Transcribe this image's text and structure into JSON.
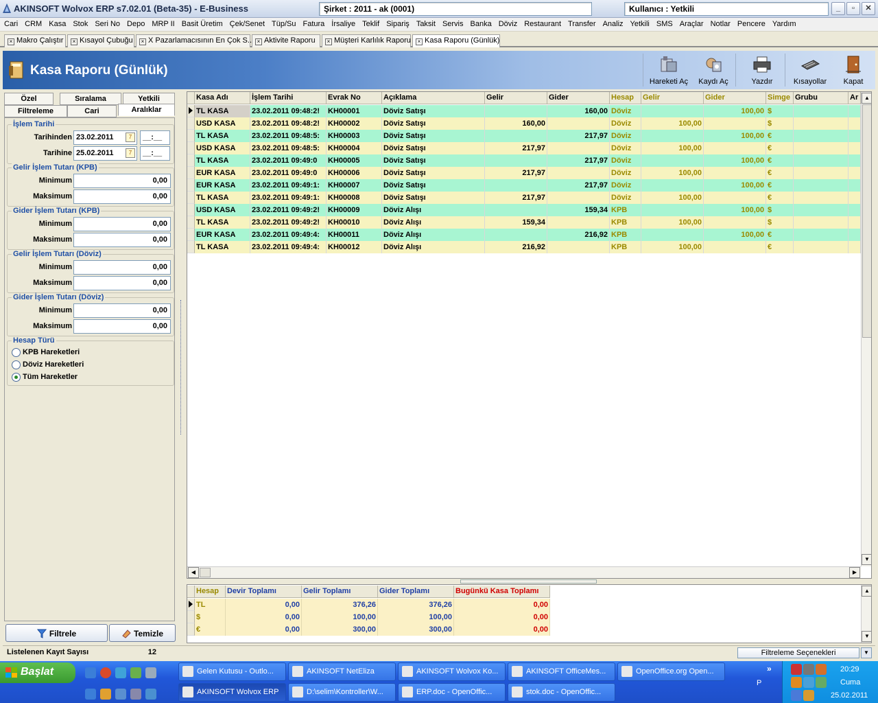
{
  "window": {
    "title": "AKINSOFT Wolvox ERP s7.02.01 (Beta-35) - E-Business",
    "company": "Şirket : 2011 - ak (0001)",
    "user": "Kullanıcı : Yetkili",
    "minimize": "_",
    "maximize": "▫",
    "close": "✕"
  },
  "menu": [
    "Cari",
    "CRM",
    "Kasa",
    "Stok",
    "Seri No",
    "Depo",
    "MRP II",
    "Basit Üretim",
    "Çek/Senet",
    "Tüp/Su",
    "Fatura",
    "İrsaliye",
    "Teklif",
    "Sipariş",
    "Taksit",
    "Servis",
    "Banka",
    "Döviz",
    "Restaurant",
    "Transfer",
    "Analiz",
    "Yetkili",
    "SMS",
    "Araçlar",
    "Notlar",
    "Pencere",
    "Yardım"
  ],
  "doc_tabs": [
    "Makro Çalıştır",
    "Kısayol Çubuğu",
    "X Pazarlamacısının En Çok S...",
    "Aktivite Raporu",
    "Müşteri Karlılık Raporu",
    "Kasa Raporu (Günlük)"
  ],
  "header": {
    "title": "Kasa Raporu (Günlük)",
    "buttons": [
      "Hareketi Aç",
      "Kaydı Aç",
      "Yazdır",
      "Kısayollar",
      "Kapat"
    ]
  },
  "left_tabs": {
    "row1": [
      "Özel",
      "Sıralama",
      "Yetkili"
    ],
    "row2": [
      "Filtreleme",
      "Cari",
      "Aralıklar"
    ]
  },
  "filters": {
    "islem_tarihi": {
      "title": "İşlem Tarihi",
      "from_label": "Tarihinden",
      "from_value": "23.02.2011",
      "to_label": "Tarihine",
      "to_value": "25.02.2011",
      "time_from": "__:__",
      "time_to": "__:__"
    },
    "gelir_kpb": {
      "title": "Gelir İşlem Tutarı (KPB)",
      "min_label": "Minimum",
      "min": "0,00",
      "max_label": "Maksimum",
      "max": "0,00"
    },
    "gider_kpb": {
      "title": "Gider İşlem Tutarı (KPB)",
      "min_label": "Minimum",
      "min": "0,00",
      "max_label": "Maksimum",
      "max": "0,00"
    },
    "gelir_doviz": {
      "title": "Gelir İşlem Tutarı (Döviz)",
      "min_label": "Minimum",
      "min": "0,00",
      "max_label": "Maksimum",
      "max": "0,00"
    },
    "gider_doviz": {
      "title": "Gider İşlem Tutarı (Döviz)",
      "min_label": "Minimum",
      "min": "0,00",
      "max_label": "Maksimum",
      "max": "0,00"
    },
    "hesap_turu": {
      "title": "Hesap Türü",
      "options": [
        "KPB Hareketleri",
        "Döviz Hareketleri",
        "Tüm Hareketler"
      ],
      "selected": "Tüm Hareketler"
    },
    "filter_button": "Filtrele",
    "clear_button": "Temizle"
  },
  "grid": {
    "columns": [
      "Kasa Adı",
      "İşlem Tarihi",
      "Evrak No",
      "Açıklama",
      "Gelir",
      "Gider",
      "Hesap",
      "Gelir",
      "Gider",
      "Simge",
      "Grubu",
      "Ar"
    ],
    "rows": [
      [
        "TL KASA",
        "23.02.2011 09:48:2!",
        "KH00001",
        "Döviz Satışı",
        "",
        "160,00",
        "Döviz",
        "",
        "100,00",
        "$"
      ],
      [
        "USD KASA",
        "23.02.2011 09:48:2!",
        "KH00002",
        "Döviz Satışı",
        "160,00",
        "",
        "Döviz",
        "100,00",
        "",
        "$"
      ],
      [
        "TL KASA",
        "23.02.2011 09:48:5:",
        "KH00003",
        "Döviz Satışı",
        "",
        "217,97",
        "Döviz",
        "",
        "100,00",
        "€"
      ],
      [
        "USD KASA",
        "23.02.2011 09:48:5:",
        "KH00004",
        "Döviz Satışı",
        "217,97",
        "",
        "Döviz",
        "100,00",
        "",
        "€"
      ],
      [
        "TL KASA",
        "23.02.2011 09:49:0",
        "KH00005",
        "Döviz Satışı",
        "",
        "217,97",
        "Döviz",
        "",
        "100,00",
        "€"
      ],
      [
        "EUR KASA",
        "23.02.2011 09:49:0",
        "KH00006",
        "Döviz Satışı",
        "217,97",
        "",
        "Döviz",
        "100,00",
        "",
        "€"
      ],
      [
        "EUR KASA",
        "23.02.2011 09:49:1:",
        "KH00007",
        "Döviz Satışı",
        "",
        "217,97",
        "Döviz",
        "",
        "100,00",
        "€"
      ],
      [
        "TL KASA",
        "23.02.2011 09:49:1:",
        "KH00008",
        "Döviz Satışı",
        "217,97",
        "",
        "Döviz",
        "100,00",
        "",
        "€"
      ],
      [
        "USD KASA",
        "23.02.2011 09:49:2!",
        "KH00009",
        "Döviz Alışı",
        "",
        "159,34",
        "KPB",
        "",
        "100,00",
        "$"
      ],
      [
        "TL KASA",
        "23.02.2011 09:49:2!",
        "KH00010",
        "Döviz Alışı",
        "159,34",
        "",
        "KPB",
        "100,00",
        "",
        "$"
      ],
      [
        "EUR KASA",
        "23.02.2011 09:49:4:",
        "KH00011",
        "Döviz Alışı",
        "",
        "216,92",
        "KPB",
        "",
        "100,00",
        "€"
      ],
      [
        "TL KASA",
        "23.02.2011 09:49:4:",
        "KH00012",
        "Döviz Alışı",
        "216,92",
        "",
        "KPB",
        "100,00",
        "",
        "€"
      ]
    ],
    "row_colors": {
      "odd": "#a8f5d2",
      "even": "#f7f3bf",
      "selected_cell": "#d4d0c8"
    }
  },
  "summary": {
    "columns": [
      "Hesap",
      "Devir Toplamı",
      "Gelir Toplamı",
      "Gider Toplamı",
      "Bugünkü Kasa Toplamı"
    ],
    "rows": [
      [
        "TL",
        "0,00",
        "376,26",
        "376,26",
        "0,00"
      ],
      [
        "$",
        "0,00",
        "100,00",
        "100,00",
        "0,00"
      ],
      [
        "€",
        "0,00",
        "300,00",
        "300,00",
        "0,00"
      ]
    ]
  },
  "status": {
    "record_label": "Listelenen Kayıt Sayısı",
    "record_count": "12",
    "filter_options": "Filtreleme Seçenekleri"
  },
  "taskbar": {
    "start": "Başlat",
    "row1": [
      "Gelen Kutusu - Outlo...",
      "AKINSOFT NetEliza",
      "AKINSOFT Wolvox Ko...",
      "AKINSOFT OfficeMes...",
      "OpenOffice.org Open..."
    ],
    "row2": [
      "AKINSOFT Wolvox ERP",
      "D:\\selim\\Kontroller\\W...",
      "ERP.doc - OpenOffic...",
      "stok.doc - OpenOffic..."
    ],
    "lang": "P",
    "expand": "»",
    "time": "20:29",
    "day": "Cuma",
    "date": "25.02.2011"
  }
}
